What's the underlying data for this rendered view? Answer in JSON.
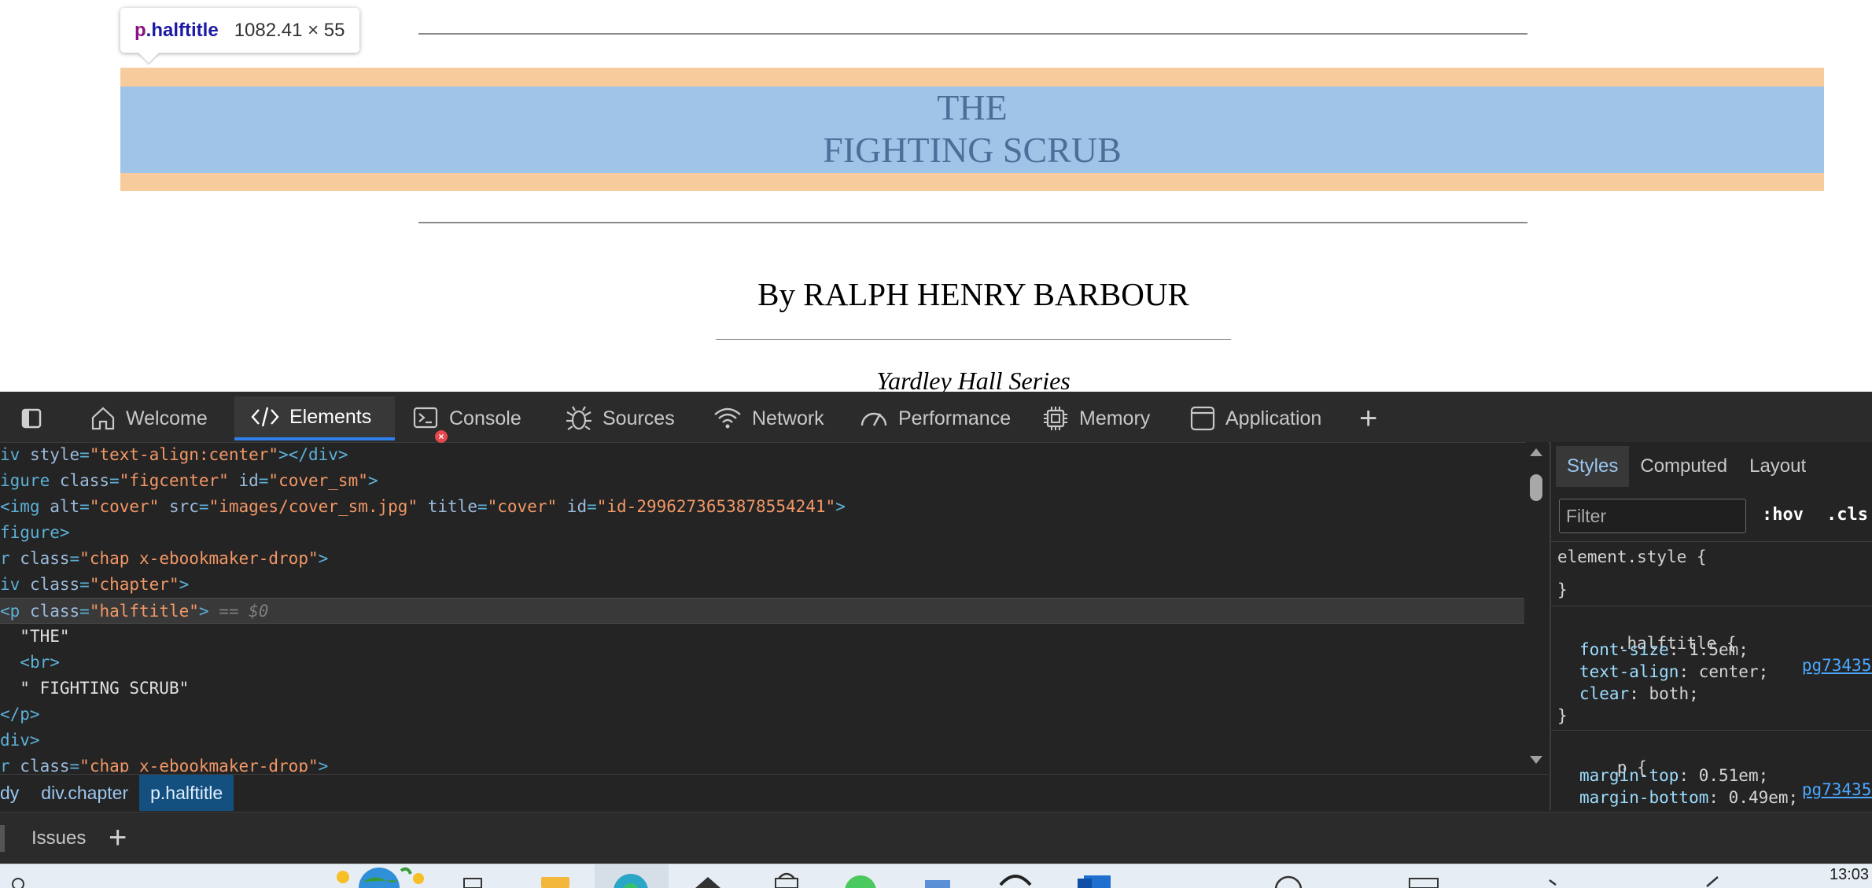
{
  "page": {
    "halftitle_line1": "THE",
    "halftitle_line2": "FIGHTING SCRUB",
    "author": "By RALPH HENRY BARBOUR",
    "series": "Yardley Hall Series"
  },
  "tooltip": {
    "tag": "p",
    "class": ".halftitle",
    "size": "1082.41 × 55"
  },
  "devtools": {
    "tabs": [
      {
        "label": "Welcome",
        "icon": "home-icon"
      },
      {
        "label": "Elements",
        "icon": "code-icon"
      },
      {
        "label": "Console",
        "icon": "console-icon"
      },
      {
        "label": "Sources",
        "icon": "bug-icon"
      },
      {
        "label": "Network",
        "icon": "wifi-icon"
      },
      {
        "label": "Performance",
        "icon": "gauge-icon"
      },
      {
        "label": "Memory",
        "icon": "chip-icon"
      },
      {
        "label": "Application",
        "icon": "window-icon"
      }
    ],
    "add_tab": "+",
    "dom": {
      "l1_tag_open": "iv ",
      "l1_attr": "style",
      "l1_val": "\"text-align:center\"",
      "l1_close": "></div>",
      "l2_tag_open": "igure ",
      "l2_attr1": "class",
      "l2_val1": "\"figcenter\"",
      "l2_attr2": "id",
      "l2_val2": "\"cover_sm\"",
      "l2_close": ">",
      "l3_tag_open": "<img ",
      "l3_attr1": "alt",
      "l3_val1": "\"cover\"",
      "l3_attr2": "src",
      "l3_val2": "\"images/cover_sm.jpg\"",
      "l3_attr3": "title",
      "l3_val3": "\"cover\"",
      "l3_attr4": "id",
      "l3_val4": "\"id-2996273653878554241\"",
      "l3_close": ">",
      "l4": "figure>",
      "l5_tag_open": "r ",
      "l5_attr": "class",
      "l5_val": "\"chap x-ebookmaker-drop\"",
      "l5_close": ">",
      "l6_tag_open": "iv ",
      "l6_attr": "class",
      "l6_val": "\"chapter\"",
      "l6_close": ">",
      "l7_tag_open": "<p ",
      "l7_attr": "class",
      "l7_val": "\"halftitle\"",
      "l7_close": ">",
      "l7_eq": " == $0",
      "l8": "\"THE\"",
      "l9": "<br>",
      "l10": "\" FIGHTING SCRUB\"",
      "l11": "</p>",
      "l12": "div>",
      "l13_tag_open": "r ",
      "l13_attr": "class",
      "l13_val": "\"chap x-ebookmaker-drop\"",
      "l13_close": ">"
    },
    "breadcrumbs": [
      "dy",
      "div.chapter",
      "p.halftitle"
    ],
    "styles": {
      "tabs": [
        "Styles",
        "Computed",
        "Layout"
      ],
      "filter_placeholder": "Filter",
      "hov": ":hov",
      "cls": ".cls",
      "element_style_open": "element.style {",
      "element_style_close": "}",
      "rule1_selector": ".halftitle {",
      "rule1_source": "pg73435-",
      "rule1_props": [
        {
          "name": "font-size",
          "value": " 1.5em;"
        },
        {
          "name": "text-align",
          "value": " center;"
        },
        {
          "name": "clear",
          "value": " both;"
        }
      ],
      "rule1_close": "}",
      "rule2_selector": "p {",
      "rule2_source": "pg73435-",
      "rule2_props": [
        {
          "name": "margin-top",
          "value": " 0.51em;"
        },
        {
          "name": "margin-bottom",
          "value": " 0.49em;"
        }
      ]
    },
    "drawer": {
      "issues": "Issues",
      "add": "+"
    }
  },
  "taskbar": {
    "time": "13:03"
  },
  "colors": {
    "margin_highlight": "#f8cb9c",
    "content_highlight": "#9fc4e8",
    "active_tab_underline": "#2f80ed"
  }
}
